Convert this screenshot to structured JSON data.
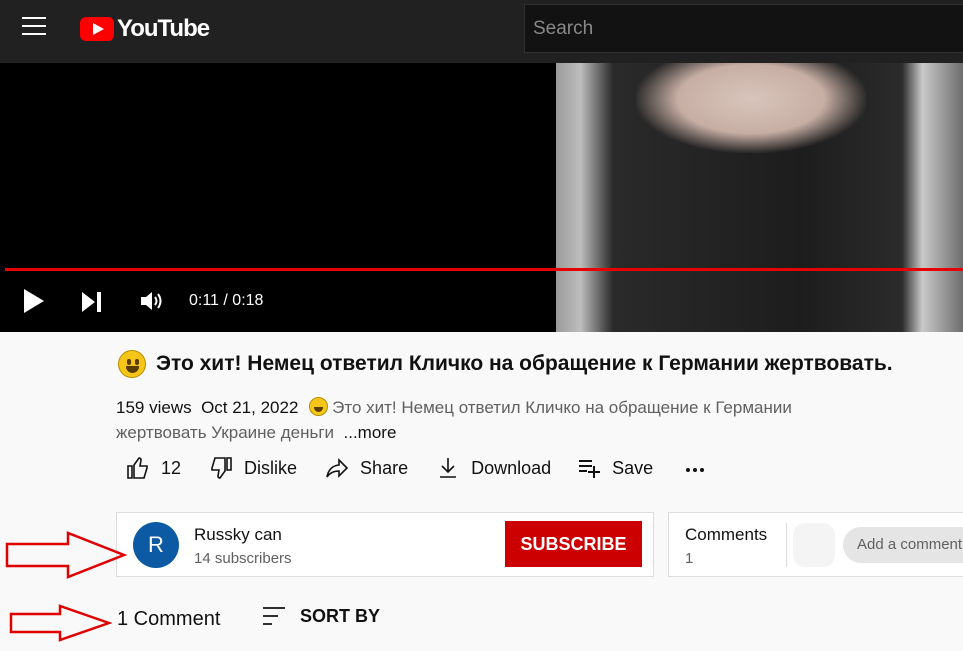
{
  "header": {
    "logo_text": "YouTube",
    "search_placeholder": "Search"
  },
  "player": {
    "time": "0:11 / 0:18",
    "progress": 1.0
  },
  "video": {
    "title": "Это хит! Немец ответил Кличко на обращение к Германии жертвовать.",
    "views": "159 views",
    "date": "Oct 21, 2022",
    "description_line1": "Это хит! Немец ответил Кличко на обращение к Германии",
    "description_line2": "жертвовать Украине деньги",
    "more_label": "...more"
  },
  "actions": {
    "like_count": "12",
    "dislike_label": "Dislike",
    "share_label": "Share",
    "download_label": "Download",
    "save_label": "Save",
    "more_label": "..."
  },
  "channel": {
    "avatar_letter": "R",
    "avatar_color": "#0b5aa3",
    "name": "Russky can",
    "subscribers": "14 subscribers",
    "subscribe_label": "SUBSCRIBE"
  },
  "comments_panel": {
    "title": "Comments",
    "count": "1",
    "add_placeholder": "Add a comment"
  },
  "comments_section": {
    "count_label": "1 Comment",
    "sort_label": "SORT BY"
  },
  "colors": {
    "accent": "#cc0000",
    "annotation_arrow": "#e00000"
  }
}
